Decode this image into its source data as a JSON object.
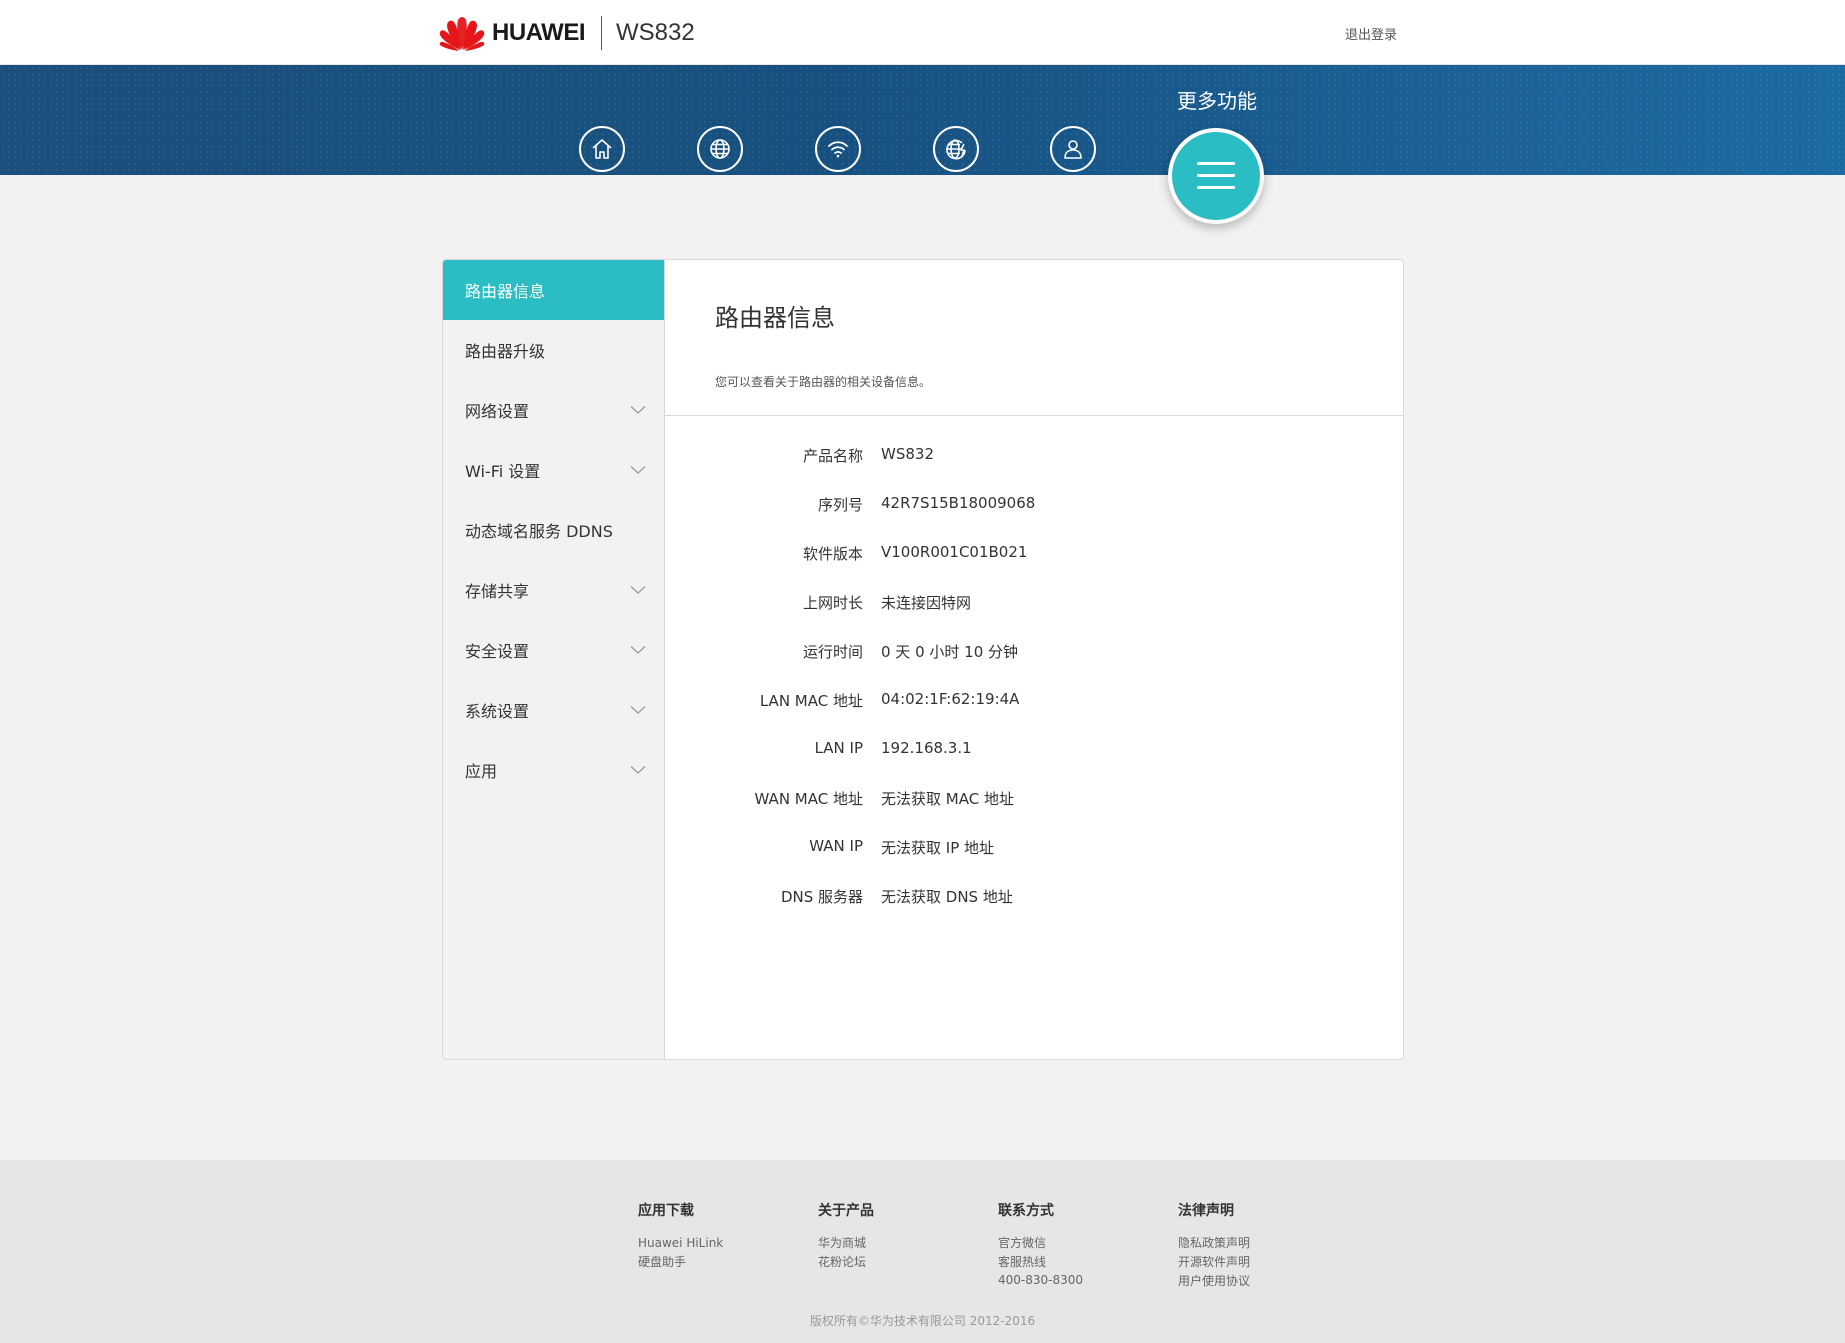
{
  "header": {
    "brand": "HUAWEI",
    "model": "WS832",
    "logout": "退出登录"
  },
  "nav": {
    "icons": [
      "home-icon",
      "globe-icon",
      "wifi-icon",
      "globe-flash-icon",
      "user-icon"
    ],
    "more_label": "更多功能",
    "more_icon": "hamburger-icon"
  },
  "colors": {
    "accent": "#2bbdc4",
    "banner": "#17507f",
    "brand_red": "#e5161a"
  },
  "sidebar": {
    "items": [
      {
        "label": "路由器信息",
        "active": true,
        "expandable": false
      },
      {
        "label": "路由器升级",
        "active": false,
        "expandable": false
      },
      {
        "label": "网络设置",
        "active": false,
        "expandable": true
      },
      {
        "label": "Wi-Fi 设置",
        "active": false,
        "expandable": true
      },
      {
        "label": "动态域名服务 DDNS",
        "active": false,
        "expandable": false
      },
      {
        "label": "存储共享",
        "active": false,
        "expandable": true
      },
      {
        "label": "安全设置",
        "active": false,
        "expandable": true
      },
      {
        "label": "系统设置",
        "active": false,
        "expandable": true
      },
      {
        "label": "应用",
        "active": false,
        "expandable": true
      }
    ]
  },
  "main": {
    "title": "路由器信息",
    "description": "您可以查看关于路由器的相关设备信息。",
    "rows": [
      {
        "label": "产品名称",
        "value": "WS832"
      },
      {
        "label": "序列号",
        "value": "42R7S15B18009068"
      },
      {
        "label": "软件版本",
        "value": "V100R001C01B021"
      },
      {
        "label": "上网时长",
        "value": "未连接因特网"
      },
      {
        "label": "运行时间",
        "value": "0 天 0 小时 10 分钟"
      },
      {
        "label": "LAN MAC 地址",
        "value": "04:02:1F:62:19:4A"
      },
      {
        "label": "LAN IP",
        "value": "192.168.3.1"
      },
      {
        "label": "WAN MAC 地址",
        "value": "无法获取 MAC 地址"
      },
      {
        "label": "WAN IP",
        "value": "无法获取 IP 地址"
      },
      {
        "label": "DNS 服务器",
        "value": "无法获取 DNS 地址"
      }
    ]
  },
  "footer": {
    "columns": [
      {
        "title": "应用下载",
        "links": [
          "Huawei HiLink",
          "硬盘助手"
        ],
        "extra": ""
      },
      {
        "title": "关于产品",
        "links": [
          "华为商城",
          "花粉论坛"
        ],
        "extra": ""
      },
      {
        "title": "联系方式",
        "links": [
          "官方微信",
          "客服热线"
        ],
        "extra": "400-830-8300"
      },
      {
        "title": "法律声明",
        "links": [
          "隐私政策声明",
          "开源软件声明",
          "用户使用协议"
        ],
        "extra": ""
      }
    ],
    "copyright": "版权所有©华为技术有限公司 2012-2016"
  }
}
